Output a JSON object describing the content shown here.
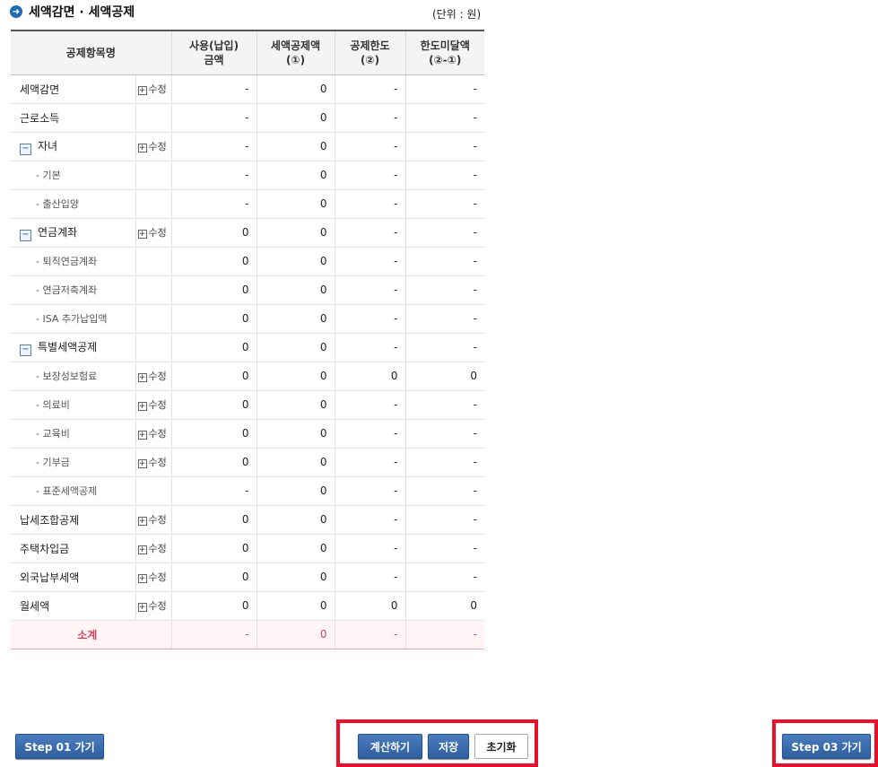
{
  "header": {
    "title": "세액감면 · 세액공제",
    "unit": "(단위 : 원)",
    "icon": "arrow-circle-icon"
  },
  "table": {
    "columns": [
      "공제항목명",
      "사용(납입)\n금액",
      "세액공제액\n(①)",
      "공제한도\n(②)",
      "한도미달액\n(②-①)"
    ],
    "rows": [
      {
        "name": "세액감면",
        "level": 0,
        "toggle": "",
        "edit": "수정",
        "values": [
          "-",
          "0",
          "-",
          "-"
        ]
      },
      {
        "name": "근로소득",
        "level": 0,
        "toggle": "",
        "edit": "",
        "values": [
          "-",
          "0",
          "-",
          "-"
        ]
      },
      {
        "name": "자녀",
        "level": 0,
        "toggle": "−",
        "edit": "수정",
        "values": [
          "-",
          "0",
          "-",
          "-"
        ]
      },
      {
        "name": "- 기본",
        "level": 1,
        "toggle": "",
        "edit": "",
        "values": [
          "-",
          "0",
          "-",
          "-"
        ]
      },
      {
        "name": "- 출산입양",
        "level": 1,
        "toggle": "",
        "edit": "",
        "values": [
          "-",
          "0",
          "-",
          "-"
        ]
      },
      {
        "name": "연금계좌",
        "level": 0,
        "toggle": "−",
        "edit": "수정",
        "values": [
          "0",
          "0",
          "-",
          "-"
        ]
      },
      {
        "name": "- 퇴직연금계좌",
        "level": 1,
        "toggle": "",
        "edit": "",
        "values": [
          "0",
          "0",
          "-",
          "-"
        ]
      },
      {
        "name": "- 연금저축계좌",
        "level": 1,
        "toggle": "",
        "edit": "",
        "values": [
          "0",
          "0",
          "-",
          "-"
        ]
      },
      {
        "name": "- ISA 추가납입액",
        "level": 1,
        "toggle": "",
        "edit": "",
        "values": [
          "0",
          "0",
          "-",
          "-"
        ]
      },
      {
        "name": "특별세액공제",
        "level": 0,
        "toggle": "−",
        "edit": "",
        "values": [
          "0",
          "0",
          "-",
          "-"
        ]
      },
      {
        "name": "- 보장성보험료",
        "level": 1,
        "toggle": "",
        "edit": "수정",
        "values": [
          "0",
          "0",
          "0",
          "0"
        ]
      },
      {
        "name": "- 의료비",
        "level": 1,
        "toggle": "",
        "edit": "수정",
        "values": [
          "0",
          "0",
          "-",
          "-"
        ]
      },
      {
        "name": "- 교육비",
        "level": 1,
        "toggle": "",
        "edit": "수정",
        "values": [
          "0",
          "0",
          "-",
          "-"
        ]
      },
      {
        "name": "- 기부금",
        "level": 1,
        "toggle": "",
        "edit": "수정",
        "values": [
          "0",
          "0",
          "-",
          "-"
        ]
      },
      {
        "name": "- 표준세액공제",
        "level": 1,
        "toggle": "",
        "edit": "",
        "values": [
          "-",
          "0",
          "-",
          "-"
        ]
      },
      {
        "name": "납세조합공제",
        "level": 0,
        "toggle": "",
        "edit": "수정",
        "values": [
          "0",
          "0",
          "-",
          "-"
        ]
      },
      {
        "name": "주택차입금",
        "level": 0,
        "toggle": "",
        "edit": "수정",
        "values": [
          "0",
          "0",
          "-",
          "-"
        ]
      },
      {
        "name": "외국납부세액",
        "level": 0,
        "toggle": "",
        "edit": "수정",
        "values": [
          "0",
          "0",
          "-",
          "-"
        ]
      },
      {
        "name": "월세액",
        "level": 0,
        "toggle": "",
        "edit": "수정",
        "values": [
          "0",
          "0",
          "0",
          "0"
        ]
      }
    ],
    "subtotal": {
      "name": "소계",
      "values": [
        "-",
        "0",
        "-",
        "-"
      ]
    }
  },
  "buttons": {
    "step01": "Step 01 가기",
    "calculate": "계산하기",
    "save": "저장",
    "reset": "초기화",
    "step03": "Step 03 가기"
  },
  "colors": {
    "accent": "#2e5f9e",
    "highlight": "#e8102a",
    "subtotal": "#d4435a"
  }
}
